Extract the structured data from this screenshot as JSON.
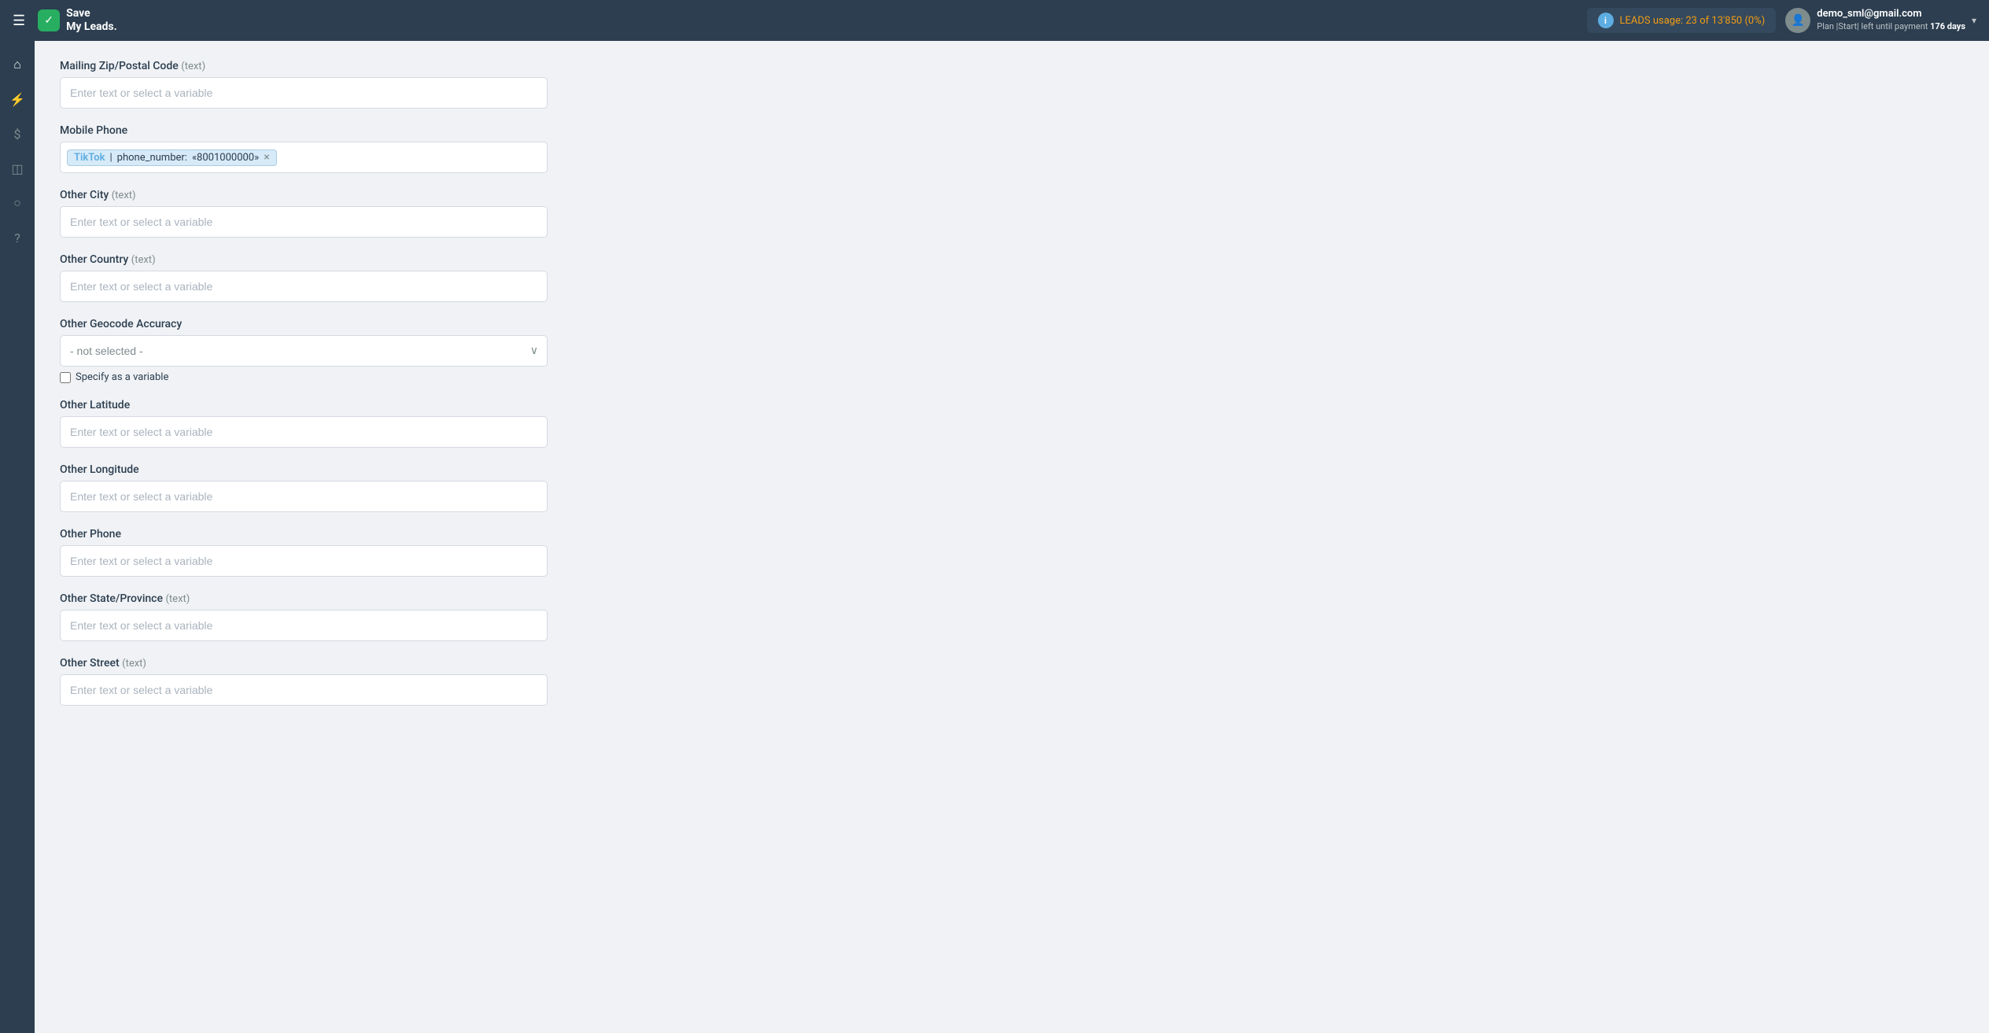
{
  "topbar": {
    "menu_icon": "☰",
    "logo_icon": "✓",
    "logo_line1": "Save",
    "logo_line2": "My Leads.",
    "leads_usage_label": "LEADS usage:",
    "leads_current": "23",
    "leads_total": "of 13'850",
    "leads_percent": "(0%)",
    "info_icon": "i",
    "user_email": "demo_sml@gmail.com",
    "user_plan_text": "Plan |Start| left until payment",
    "user_days": "176 days",
    "chevron": "▾"
  },
  "sidebar": {
    "items": [
      {
        "icon": "⌂",
        "name": "home-icon"
      },
      {
        "icon": "⚡",
        "name": "connections-icon"
      },
      {
        "icon": "$",
        "name": "billing-icon"
      },
      {
        "icon": "🗂",
        "name": "tasks-icon"
      },
      {
        "icon": "👤",
        "name": "profile-icon"
      },
      {
        "icon": "?",
        "name": "help-icon"
      }
    ]
  },
  "form": {
    "fields": [
      {
        "id": "mailing-zip",
        "label": "Mailing Zip/Postal Code",
        "type_hint": "(text)",
        "input_type": "text",
        "placeholder": "Enter text or select a variable",
        "value": ""
      },
      {
        "id": "mobile-phone",
        "label": "Mobile Phone",
        "type_hint": "",
        "input_type": "tag",
        "tag_source": "TikTok",
        "tag_field": "phone_number:",
        "tag_value": "«8001000000»"
      },
      {
        "id": "other-city",
        "label": "Other City",
        "type_hint": "(text)",
        "input_type": "text",
        "placeholder": "Enter text or select a variable",
        "value": ""
      },
      {
        "id": "other-country",
        "label": "Other Country",
        "type_hint": "(text)",
        "input_type": "text",
        "placeholder": "Enter text or select a variable",
        "value": ""
      },
      {
        "id": "other-geocode",
        "label": "Other Geocode Accuracy",
        "type_hint": "",
        "input_type": "dropdown",
        "selected_value": "- not selected -",
        "options": [
          "- not selected -"
        ],
        "has_checkbox": true,
        "checkbox_label": "Specify as a variable"
      },
      {
        "id": "other-latitude",
        "label": "Other Latitude",
        "type_hint": "",
        "input_type": "text",
        "placeholder": "Enter text or select a variable",
        "value": ""
      },
      {
        "id": "other-longitude",
        "label": "Other Longitude",
        "type_hint": "",
        "input_type": "text",
        "placeholder": "Enter text or select a variable",
        "value": ""
      },
      {
        "id": "other-phone",
        "label": "Other Phone",
        "type_hint": "",
        "input_type": "text",
        "placeholder": "Enter text or select a variable",
        "value": ""
      },
      {
        "id": "other-state",
        "label": "Other State/Province",
        "type_hint": "(text)",
        "input_type": "text",
        "placeholder": "Enter text or select a variable",
        "value": ""
      },
      {
        "id": "other-street",
        "label": "Other Street",
        "type_hint": "(text)",
        "input_type": "text",
        "placeholder": "Enter text or select a variable",
        "value": ""
      }
    ]
  }
}
